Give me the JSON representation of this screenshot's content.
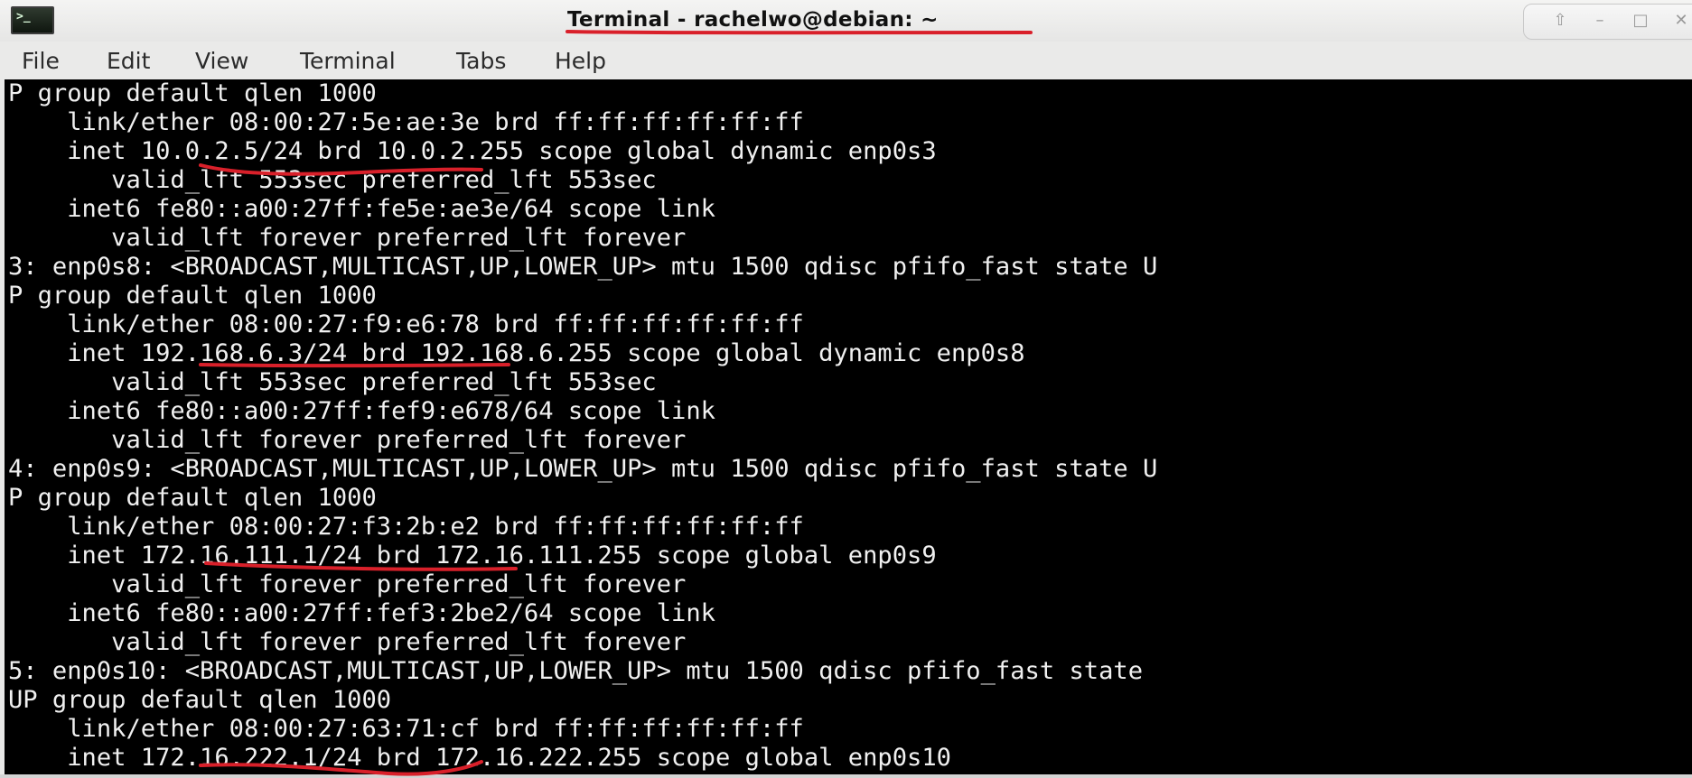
{
  "window": {
    "title": "Terminal - rachelwo@debian: ~",
    "controls": {
      "up": "⇧",
      "minimize": "–",
      "maximize": "□",
      "close": "✕"
    }
  },
  "menu": {
    "items": [
      "File",
      "Edit",
      "View",
      "Terminal",
      "Tabs",
      "Help"
    ]
  },
  "terminal": {
    "lines": [
      "P group default qlen 1000",
      "    link/ether 08:00:27:5e:ae:3e brd ff:ff:ff:ff:ff:ff",
      "    inet 10.0.2.5/24 brd 10.0.2.255 scope global dynamic enp0s3",
      "       valid_lft 553sec preferred_lft 553sec",
      "    inet6 fe80::a00:27ff:fe5e:ae3e/64 scope link",
      "       valid_lft forever preferred_lft forever",
      "3: enp0s8: <BROADCAST,MULTICAST,UP,LOWER_UP> mtu 1500 qdisc pfifo_fast state U",
      "P group default qlen 1000",
      "    link/ether 08:00:27:f9:e6:78 brd ff:ff:ff:ff:ff:ff",
      "    inet 192.168.6.3/24 brd 192.168.6.255 scope global dynamic enp0s8",
      "       valid_lft 553sec preferred_lft 553sec",
      "    inet6 fe80::a00:27ff:fef9:e678/64 scope link",
      "       valid_lft forever preferred_lft forever",
      "4: enp0s9: <BROADCAST,MULTICAST,UP,LOWER_UP> mtu 1500 qdisc pfifo_fast state U",
      "P group default qlen 1000",
      "    link/ether 08:00:27:f3:2b:e2 brd ff:ff:ff:ff:ff:ff",
      "    inet 172.16.111.1/24 brd 172.16.111.255 scope global enp0s9",
      "       valid_lft forever preferred_lft forever",
      "    inet6 fe80::a00:27ff:fef3:2be2/64 scope link",
      "       valid_lft forever preferred_lft forever",
      "5: enp0s10: <BROADCAST,MULTICAST,UP,LOWER_UP> mtu 1500 qdisc pfifo_fast state",
      "UP group default qlen 1000",
      "    link/ether 08:00:27:63:71:cf brd ff:ff:ff:ff:ff:ff",
      "    inet 172.16.222.1/24 brd 172.16.222.255 scope global enp0s10"
    ],
    "background": "#000000",
    "foreground": "#f0f0f0"
  },
  "annotation_color": "#d9202a",
  "app_icon": "terminal-icon"
}
